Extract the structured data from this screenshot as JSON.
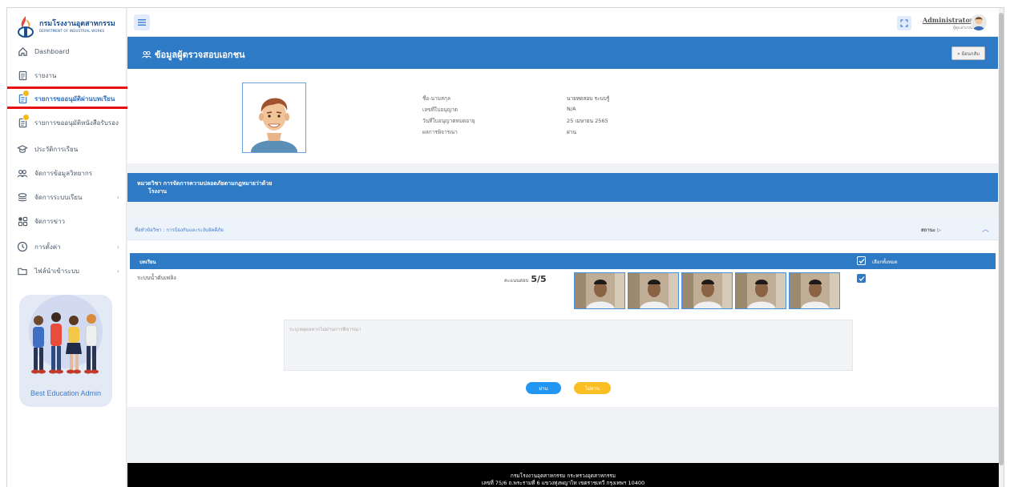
{
  "brand": {
    "name_th": "กรมโรงงานอุตสาหกรรม",
    "name_en": "DEPARTMENT OF INDUSTRIAL WORKS"
  },
  "sidebar": {
    "items": [
      {
        "label": "Dashboard",
        "icon": "home-icon"
      },
      {
        "label": "รายงาน",
        "icon": "report-icon"
      },
      {
        "label": "รายการขออนุมัติผ่านบทเรียน",
        "icon": "document-icon",
        "active": true
      },
      {
        "label": "รายการขออนุมัติหนังสือรับรอง",
        "icon": "document-icon"
      },
      {
        "label": "ประวัติการเรียน",
        "icon": "graduation-cap-icon"
      },
      {
        "label": "จัดการข้อมูลวิทยากร",
        "icon": "users-icon"
      },
      {
        "label": "จัดการระบบเรียน",
        "icon": "layers-icon"
      },
      {
        "label": "จัดการข่าว",
        "icon": "grid-icon"
      },
      {
        "label": "การตั้งค่า",
        "icon": "clock-icon"
      },
      {
        "label": "ไฟล์นำเข้าระบบ",
        "icon": "folder-icon"
      }
    ],
    "promo_text": "Best Education Admin"
  },
  "topbar": {
    "user_name": "Administrator",
    "user_role": "ผู้ดูแลระบบ"
  },
  "profile": {
    "title": "ข้อมูลผู้ตรวจสอบเอกชน",
    "back_label": "« ย้อนกลับ",
    "fields": [
      {
        "label": "ชื่อ-นามสกุล",
        "value": "นายทดสอบ ระบบรู้"
      },
      {
        "label": "เลขที่ใบอนุญาต",
        "value": "N/A"
      },
      {
        "label": "วันที่ใบอนุญาตหมดอายุ",
        "value": "25 เมษายน 2565"
      },
      {
        "label": "ผลการพิจารณา",
        "value": "ผ่าน"
      }
    ]
  },
  "course": {
    "label_line1": "หมวดวิชา การจัดการความปลอดภัยตามกฎหมายว่าด้วย",
    "label_line2": "โรงงาน"
  },
  "subject": {
    "title": "ชื่อหัวข้อวิชา : การป้องกันและระงับอัคคีภัย",
    "status_label": "สถานะ ▷",
    "lesson_header": "บทเรียน",
    "select_all": "เลือกทั้งหมด",
    "lesson_name": "ระบบน้ำดับเพลิง",
    "score_label": "คะแนนสอบ",
    "score_value": "5/5",
    "reason_placeholder": "ระบุเหตุผลหากไม่ผ่านการพิจารณา",
    "pass_label": "ผ่าน",
    "fail_label": "ไม่ผ่าน"
  },
  "footer": {
    "line1": "กรมโรงงานอุตสาหกรรม กระทรวงอุตสาหกรรม",
    "line2": "เลขที่ 75/6 ถ.พระรามที่ 6 แขวงทุ่งพญาไท เขตราชเทวี กรุงเทพฯ 10400"
  },
  "colors": {
    "primary": "#2f7ac4",
    "accent_yellow": "#fbbf24",
    "highlight_red": "#e80f0f"
  }
}
